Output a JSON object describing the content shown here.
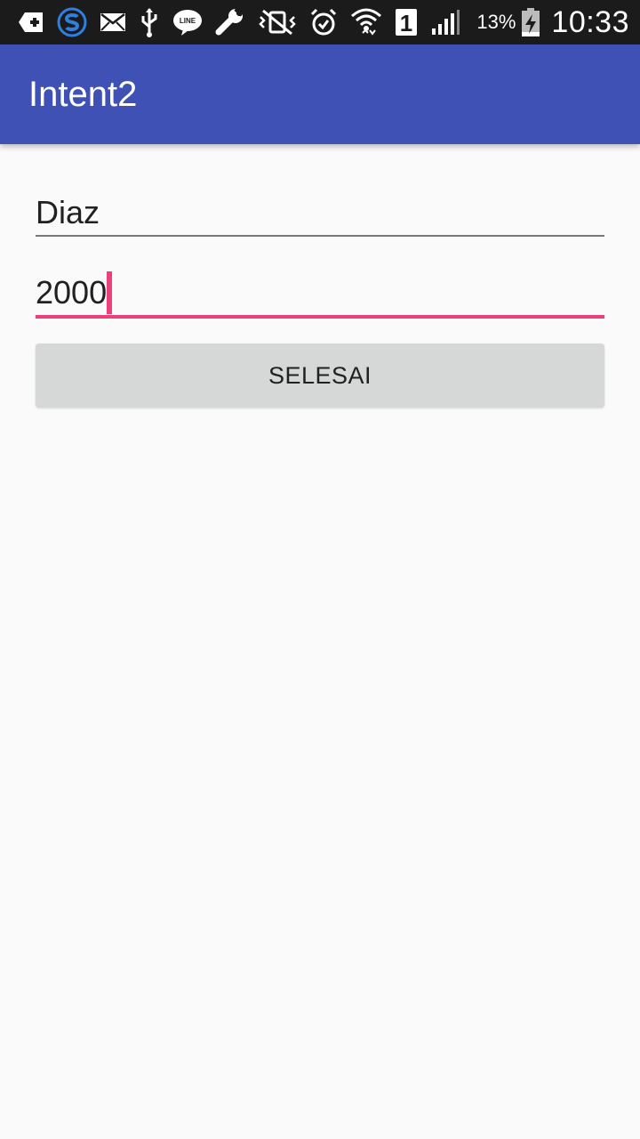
{
  "status_bar": {
    "icons_left": [
      "add-box-icon",
      "s-app-icon",
      "mail-icon",
      "usb-icon",
      "line-app-icon",
      "wrench-icon",
      "vibrate-mute-icon",
      "alarm-icon",
      "wifi-icon",
      "sim-1-icon",
      "signal-icon"
    ],
    "battery_percent": "13%",
    "time": "10:33"
  },
  "app_bar": {
    "title": "Intent2",
    "color": "#3f51b5"
  },
  "form": {
    "name_value": "Diaz",
    "number_value": "2000",
    "submit_label": "SELESAI",
    "accent_color": "#ec407a"
  }
}
